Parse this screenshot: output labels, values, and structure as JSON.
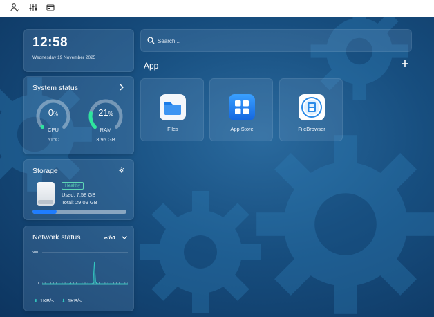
{
  "topbar": {
    "icons": [
      "user-icon",
      "sliders-icon",
      "window-icon"
    ]
  },
  "clock": {
    "time": "12:58",
    "date": "Wednesday 19 November 2025"
  },
  "system_status": {
    "title": "System status",
    "cpu": {
      "value": "0",
      "unit": "%",
      "label": "CPU",
      "sub": "51°C",
      "percent": 0
    },
    "ram": {
      "value": "21",
      "unit": "%",
      "label": "RAM",
      "sub": "3.95 GB",
      "percent": 21
    }
  },
  "storage": {
    "title": "Storage",
    "badge": "Healthy",
    "used": "Used: 7.58 GB",
    "total": "Total: 29.09 GB",
    "used_fraction": 0.26
  },
  "network": {
    "title": "Network status",
    "interface": "eth0",
    "y_max_label": "500",
    "y_min_label": "0",
    "upload": "1KB/s",
    "download": "1KB/s",
    "series": [
      2,
      2,
      2,
      2,
      2,
      2,
      2,
      2,
      2,
      2,
      2,
      2,
      2,
      2,
      2,
      2,
      2,
      2,
      2,
      2,
      2,
      3,
      2,
      2,
      2,
      2,
      2,
      2,
      2,
      2,
      2,
      2,
      2,
      2,
      2,
      2,
      2,
      2,
      4,
      60,
      6,
      3,
      2,
      2,
      2,
      2,
      2,
      2,
      2,
      2,
      2,
      2,
      2,
      2,
      2,
      2,
      2,
      2,
      2,
      2,
      2,
      2,
      2,
      2,
      2
    ],
    "y_range": [
      0,
      500
    ],
    "accent": "#33c7c0"
  },
  "search": {
    "placeholder": "Search..."
  },
  "apps": {
    "heading": "App",
    "items": [
      {
        "label": "Files",
        "icon": "folder-icon"
      },
      {
        "label": "App Store",
        "icon": "app-store-icon"
      },
      {
        "label": "FileBrowser",
        "icon": "filebrowser-icon"
      }
    ]
  },
  "colors": {
    "accent_blue": "#1f7dff",
    "gauge_green": "#2ee59d",
    "healthy": "#5fd6b6"
  }
}
